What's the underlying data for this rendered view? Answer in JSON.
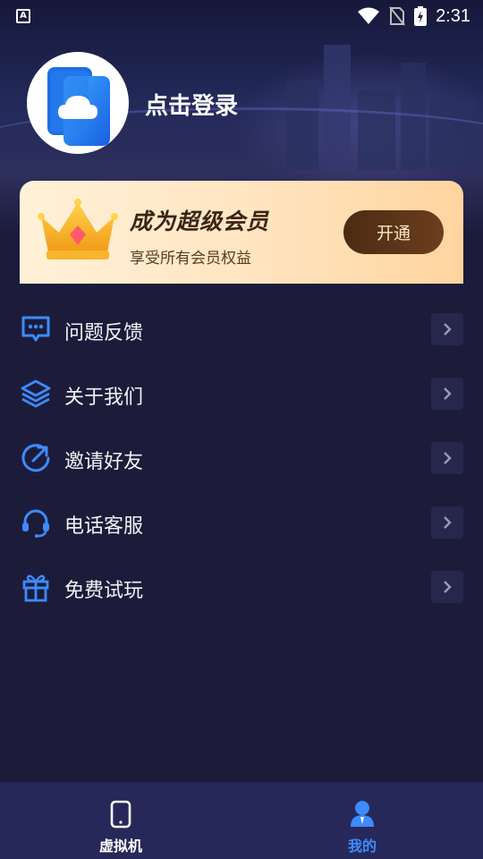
{
  "status_bar": {
    "left_icon": "a-notification-icon",
    "time": "2:31",
    "icons": [
      "wifi-icon",
      "no-sim-icon",
      "battery-charging-icon"
    ]
  },
  "profile": {
    "avatar_icon": "cloud-phone-icon",
    "login_text": "点击登录"
  },
  "vip_card": {
    "crown_icon": "crown-icon",
    "title": "成为超级会员",
    "subtitle": "享受所有会员权益",
    "button_label": "开通"
  },
  "menu": {
    "items": [
      {
        "label": "问题反馈",
        "icon": "feedback-chat-icon"
      },
      {
        "label": "关于我们",
        "icon": "layers-icon"
      },
      {
        "label": "邀请好友",
        "icon": "share-arrow-circle-icon"
      },
      {
        "label": "电话客服",
        "icon": "headset-icon"
      },
      {
        "label": "免费试玩",
        "icon": "gift-icon"
      }
    ]
  },
  "tabbar": {
    "tabs": [
      {
        "label": "虚拟机",
        "icon": "phone-icon",
        "active": false
      },
      {
        "label": "我的",
        "icon": "person-icon",
        "active": true
      }
    ]
  },
  "colors": {
    "background": "#1c1c3a",
    "accent_blue": "#3d8bff",
    "tabbar": "#262859",
    "vip_button": "#5a3419",
    "vip_gold": "#ffe4bf"
  }
}
